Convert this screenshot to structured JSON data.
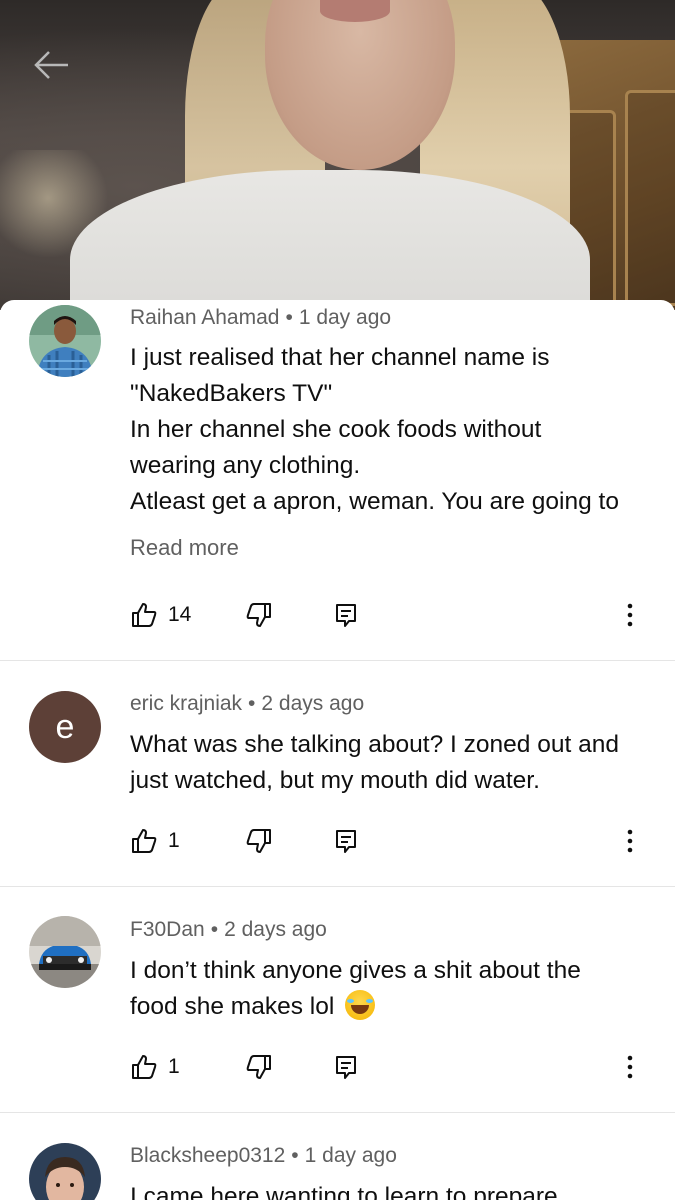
{
  "header": {
    "back_icon": "arrow-left-icon"
  },
  "comments": [
    {
      "author": "Raihan Ahamad",
      "time": "1 day ago",
      "lines": [
        "I just realised that her channel name is",
        "\"NakedBakers TV\"",
        "In her channel she cook foods without",
        "wearing any clothing.",
        "Atleast get a apron, weman. You are going to"
      ],
      "read_more": "Read more",
      "likes": "14",
      "avatar": "photo-avatar"
    },
    {
      "author": "eric krajniak",
      "time": "2 days ago",
      "lines": [
        "What was she talking about? I zoned out and",
        "just watched, but my mouth did water."
      ],
      "likes": "1",
      "avatar_letter": "e",
      "avatar_color": "#5d4037"
    },
    {
      "author": "F30Dan",
      "time": "2 days ago",
      "lines": [
        "I don’t think anyone gives a shit about the",
        "food she makes lol"
      ],
      "emoji": "face-with-tears-of-joy-emoji",
      "likes": "1",
      "avatar": "car-photo-avatar"
    },
    {
      "author": "Blacksheep0312",
      "time": "1 day ago",
      "lines": [
        "I came here wanting to learn to prepare"
      ],
      "avatar": "photo-avatar"
    }
  ],
  "actions": {
    "like_icon": "thumbs-up-icon",
    "dislike_icon": "thumbs-down-icon",
    "reply_icon": "reply-comment-icon",
    "more_icon": "more-vertical-icon"
  }
}
